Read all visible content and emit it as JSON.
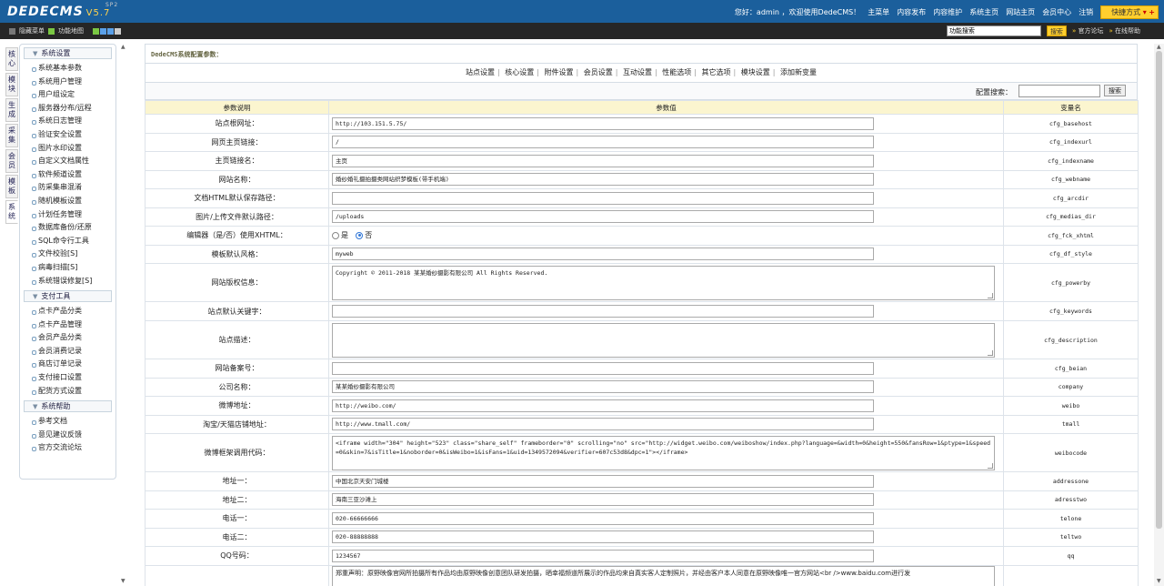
{
  "topbar": {
    "logo": "DEDECMS",
    "version": "V5.7",
    "version_suffix": "SP2",
    "greeting": "您好：admin ，欢迎使用DedeCMS！",
    "nav": [
      "主菜单",
      "内容发布",
      "内容维护",
      "系统主页",
      "网站主页",
      "会员中心",
      "注销"
    ],
    "quick": "快捷方式"
  },
  "subbar": {
    "hide_menu": "隐藏菜单",
    "func_map": "功能地图",
    "search_value": "功能搜索",
    "search_btn": "搜索",
    "forum": "官方论坛",
    "help": "在线帮助"
  },
  "left_tabs": [
    "核心",
    "模块",
    "生成",
    "采集",
    "会员",
    "模板",
    "系统"
  ],
  "sidebar": [
    {
      "title": "系统设置",
      "items": [
        "系统基本参数",
        "系统用户管理",
        "用户组设定",
        "服务器分布/远程",
        "系统日志管理",
        "验证安全设置",
        "图片水印设置",
        "自定义文档属性",
        "软件频道设置",
        "防采集串混淆",
        "随机模板设置",
        "计划任务管理",
        "数据库备份/还原",
        "SQL命令行工具",
        "文件校验[S]",
        "病毒扫描[S]",
        "系统错误修复[S]"
      ]
    },
    {
      "title": "支付工具",
      "items": [
        "点卡产品分类",
        "点卡产品管理",
        "会员产品分类",
        "会员消费记录",
        "商店订单记录",
        "支付接口设置",
        "配货方式设置"
      ]
    },
    {
      "title": "系统帮助",
      "items": [
        "参考文档",
        "意见建议反馈",
        "官方交流论坛"
      ]
    }
  ],
  "main": {
    "title": "DedeCMS系统配置参数：",
    "tabs": [
      "站点设置",
      "核心设置",
      "附件设置",
      "会员设置",
      "互动设置",
      "性能选项",
      "其它选项",
      "模块设置",
      "添加新变量"
    ],
    "search_label": "配置搜索：",
    "search_btn": "搜索",
    "headers": [
      "参数说明",
      "参数值",
      "变量名"
    ],
    "rows": [
      {
        "label": "站点根网址：",
        "type": "input",
        "value": "http://103.151.5.75/",
        "var": "cfg_basehost"
      },
      {
        "label": "网页主页链接：",
        "type": "input",
        "value": "/",
        "var": "cfg_indexurl"
      },
      {
        "label": "主页链接名：",
        "type": "input",
        "value": "主页",
        "var": "cfg_indexname"
      },
      {
        "label": "网站名称：",
        "type": "input",
        "value": "婚纱婚礼摄拍摄类网站织梦模板(带手机端)",
        "var": "cfg_webname"
      },
      {
        "label": "文档HTML默认保存路径：",
        "type": "input",
        "value": "",
        "var": "cfg_arcdir"
      },
      {
        "label": "图片/上传文件默认路径：",
        "type": "input",
        "value": "/uploads",
        "var": "cfg_medias_dir"
      },
      {
        "label": "编辑器（是/否）使用XHTML：",
        "type": "radio",
        "options": [
          "是",
          "否"
        ],
        "selected": "否",
        "var": "cfg_fck_xhtml"
      },
      {
        "label": "模板默认风格：",
        "type": "input",
        "value": "myweb",
        "var": "cfg_df_style"
      },
      {
        "label": "网站版权信息：",
        "type": "textarea",
        "value": "Copyright © 2011-2018 某某婚纱摄影有限公司 All Rights Reserved.",
        "var": "cfg_powerby"
      },
      {
        "label": "站点默认关键字：",
        "type": "input",
        "value": "",
        "var": "cfg_keywords"
      },
      {
        "label": "站点描述：",
        "type": "textarea",
        "value": "",
        "var": "cfg_description"
      },
      {
        "label": "网站备案号：",
        "type": "input",
        "value": "",
        "var": "cfg_beian"
      },
      {
        "label": "公司名称：",
        "type": "input",
        "value": "某某婚纱摄影有限公司",
        "var": "company"
      },
      {
        "label": "微博地址：",
        "type": "input",
        "value": "http://weibo.com/",
        "var": "weibo"
      },
      {
        "label": "淘宝/天猫店铺地址：",
        "type": "input",
        "value": "http://www.tmall.com/",
        "var": "tmall"
      },
      {
        "label": "微博框架调用代码：",
        "type": "textarea",
        "value": "<iframe width=\"304\" height=\"523\" class=\"share_self\"  frameborder=\"0\" scrolling=\"no\" src=\"http://widget.weibo.com/weiboshow/index.php?language=&width=0&height=550&fansRow=1&ptype=1&speed=0&skin=7&isTitle=1&noborder=0&isWeibo=1&isFans=1&uid=1349572094&verifier=607c53d8&dpc=1\"></iframe>",
        "var": "weibocode"
      },
      {
        "label": "地址一：",
        "type": "input",
        "value": "中国北京天安门城楼",
        "var": "addressone"
      },
      {
        "label": "地址二：",
        "type": "input",
        "value": "海南三亚沙滩上",
        "var": "adresstwo"
      },
      {
        "label": "电话一：",
        "type": "input",
        "value": "020-66666666",
        "var": "telone"
      },
      {
        "label": "电话二：",
        "type": "input",
        "value": "020-88888888",
        "var": "teltwo"
      },
      {
        "label": "QQ号码：",
        "type": "input",
        "value": "1234567",
        "var": "qq"
      },
      {
        "label": "",
        "type": "textarea",
        "value": "郑重声明：原野映像官网所拍摄所有作品均由原野映像创意团队研发拍摄，晒幸福频道所展示的作品均来自真实客人定制照片，并经由客户本人同意在原野映像唯一官方网站<br />www.baidu.com进行发",
        "var": ""
      }
    ]
  }
}
